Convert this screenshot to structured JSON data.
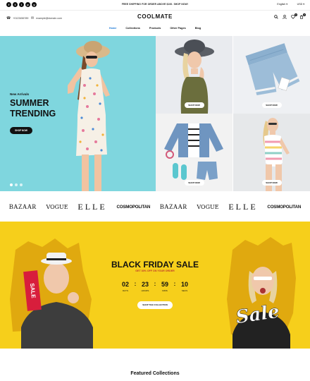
{
  "topbar": {
    "socials": [
      "f",
      "t",
      "i",
      "p",
      "y"
    ],
    "promo": "FREE SHIPPING FOR ORDER ABOVE $100. SHOP NOW!",
    "language": "English ▾",
    "currency": "USD ▾"
  },
  "header": {
    "phone": "+0123456789",
    "email": "example@domain.com",
    "logo": "COOLMATE",
    "cart_count": "0",
    "wishlist_count": "0"
  },
  "nav": [
    "Home",
    "Collections",
    "Products",
    "Other Pages",
    "Blog"
  ],
  "hero": {
    "kicker": "New Arrivals",
    "title": "SUMMER TRENDING",
    "button": "SHOP NOW"
  },
  "tiles": [
    "SHOP NOW",
    "SHOP NOW",
    "SHOP NOW",
    "SHOP NOW"
  ],
  "brands": [
    "BAZAAR",
    "VOGUE",
    "ELLE",
    "COSMOPOLITAN",
    "BAZAAR",
    "VOGUE",
    "ELLE",
    "COSMOPOLITAN"
  ],
  "black_friday": {
    "title": "BLACK FRIDAY SALE",
    "subtitle": "GET 30% OFF ON YOUR ORDER",
    "sale_sign_left": "SALE",
    "sale_sign_right": "Sale",
    "countdown": [
      {
        "num": "02",
        "label": "DAYS"
      },
      {
        "num": "23",
        "label": "HOURS"
      },
      {
        "num": "59",
        "label": "MINS"
      },
      {
        "num": "10",
        "label": "SECS"
      }
    ],
    "button": "SHOP THE COLLECTION"
  },
  "featured": "Featured Collections",
  "colors": {
    "hero_bg": "#7fd6de",
    "banner_bg": "#f6cf1b",
    "nav_active": "#1e7ad6"
  }
}
